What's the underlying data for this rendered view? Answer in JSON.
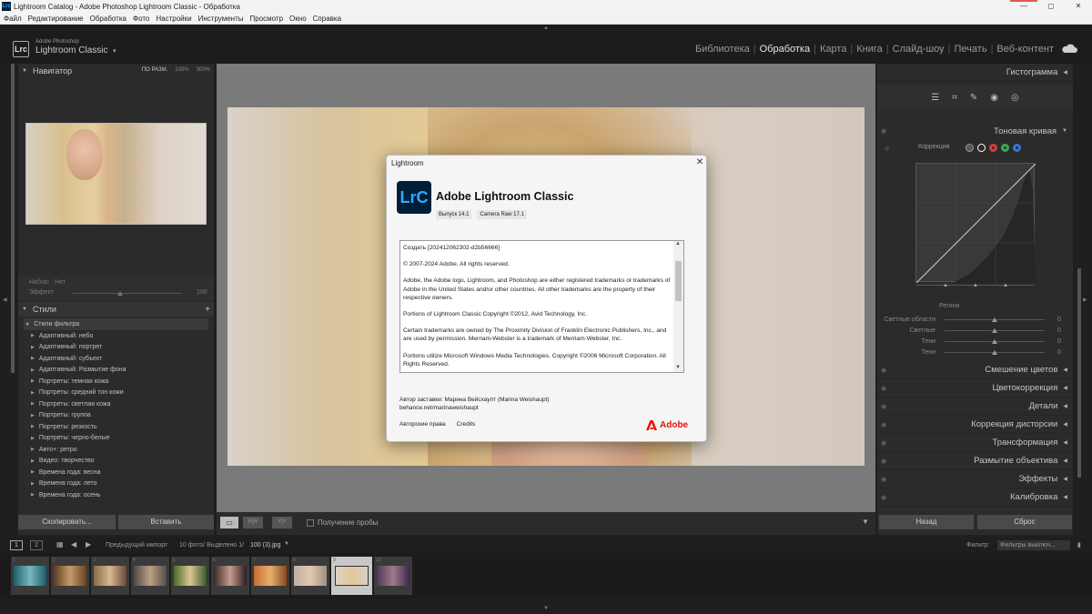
{
  "window": {
    "title": "Lightroom Catalog - Adobe Photoshop Lightroom Classic - Обработка",
    "app_icon": "Lrc",
    "min": "—",
    "max": "◻",
    "close": "✕"
  },
  "menu": [
    "Файл",
    "Редактирование",
    "Обработка",
    "Фото",
    "Настройки",
    "Инструменты",
    "Просмотр",
    "Окно",
    "Справка"
  ],
  "identity": {
    "logo": "Lrc",
    "small": "Adobe Photoshop",
    "big": "Lightroom Classic",
    "caret": "▾"
  },
  "modules": [
    {
      "label": "Библиотека",
      "active": false
    },
    {
      "label": "Обработка",
      "active": true
    },
    {
      "label": "Карта",
      "active": false
    },
    {
      "label": "Книга",
      "active": false
    },
    {
      "label": "Слайд-шоу",
      "active": false
    },
    {
      "label": "Печать",
      "active": false
    },
    {
      "label": "Веб-контент",
      "active": false
    }
  ],
  "navigator": {
    "title": "Навигатор",
    "opts": [
      "ПО РАЗМ.",
      "100%",
      "300%"
    ]
  },
  "presets": {
    "set_label": "Набор:",
    "set_value": "Нет",
    "amount_label": "Эффект",
    "amount_value": "100"
  },
  "styles": {
    "title": "Стили",
    "plus": "+",
    "filter_label": "Стили фильтра",
    "items": [
      "Адаптивный: небо",
      "Адаптивный: портрет",
      "Адаптивный: субъект",
      "Адаптивный: Размытие фона",
      "Портреты: темная кожа",
      "Портреты: средний тон кожи",
      "Портреты: светлая кожа",
      "Портреты: группа",
      "Портреты: резкость",
      "Портреты: черно-белые",
      "Авто+: ретро",
      "Видео: творчество",
      "Времена года: весна",
      "Времена года: лето",
      "Времена года: осень"
    ]
  },
  "left_buttons": {
    "copy": "Скопировать...",
    "paste": "Вставить"
  },
  "toolbar": {
    "soft_proof": "Получение пробы",
    "view_btns": [
      "▭",
      "R|R",
      "Y|Y"
    ]
  },
  "right": {
    "histogram": "Гистограмма",
    "tone_curve": "Тоновая кривая",
    "correction": "Коррекция",
    "region": "Регион",
    "sliders": [
      {
        "label": "Светлые области",
        "value": "0"
      },
      {
        "label": "Светлые",
        "value": "0"
      },
      {
        "label": "Тени",
        "value": "0"
      },
      {
        "label": "Тени",
        "value": "0"
      }
    ],
    "sections": [
      "Смешение цветов",
      "Цветокоррекция",
      "Детали",
      "Коррекция дисторсии",
      "Трансформация",
      "Размытие объектива",
      "Эффекты",
      "Калибровка"
    ],
    "reset_prev": "Назад",
    "reset": "Сброс",
    "curve_dot_colors": [
      "#ffffff",
      "#e23b3b",
      "#38b24d",
      "#3a78e0"
    ]
  },
  "filmstrip": {
    "pages": [
      "1",
      "2"
    ],
    "source": "Предыдущий импорт",
    "count": "10 фото/ Выделено 1/",
    "file": "100 (3).jpg",
    "filter_label": "Фильтр:",
    "filter_value": "Фильтры выключ...",
    "thumbs": [
      "1",
      "2",
      "3",
      "4",
      "5",
      "6",
      "7",
      "8",
      "9",
      "10"
    ],
    "selected_index": 8
  },
  "dialog": {
    "title": "Lightroom",
    "close": "✕",
    "logo": "LrC",
    "app_name": "Adobe Lightroom Classic",
    "version": "Выпуск 14.1",
    "camera_raw": "Camera Raw 17.1",
    "paragraphs": [
      "Создать [202412062302-d2b56666]",
      "© 2007-2024 Adobe. All rights reserved.",
      "Adobe, the Adobe logo, Lightroom, and Photoshop are either registered trademarks or trademarks of Adobe in the United States and/or other countries. All other trademarks are the property of their respective owners.",
      "Portions of Lightroom Classic Copyright ©2012, Avid Technology, Inc.",
      "Certain trademarks are owned by The Proximity Division of Franklin Electronic Publishers, Inc., and are used by permission. Merriam-Webster is a trademark of Merriam-Webster, Inc.",
      "Portions utilize Microsoft Windows Media Technologies. Copyright ©2006 Microsoft Corporation. All Rights Reserved."
    ],
    "credit_author": "Автор заставки: Марина Вейсхаупт (Marina Weishaupt)",
    "credit_link": "behance.net/marinaweishaupt",
    "link_copyright": "Авторские права",
    "link_credits": "Credits",
    "adobe": "Adobe"
  }
}
